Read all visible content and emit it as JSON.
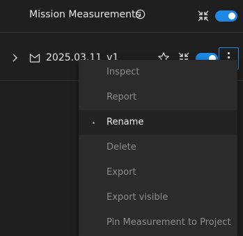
{
  "header": {
    "title": "Mission Measurements",
    "toggle_on": true,
    "accent_color": "#1e88e5"
  },
  "layer_row": {
    "title": "2025.03.11_v1",
    "toggle_on": true
  },
  "context_menu": {
    "items": [
      {
        "label": "Inspect"
      },
      {
        "label": "Report"
      },
      {
        "label": "Rename"
      },
      {
        "label": "Delete"
      },
      {
        "label": "Export"
      },
      {
        "label": "Export visible"
      },
      {
        "label": "Pin Measurement to Project"
      }
    ],
    "active_item": "Rename"
  },
  "icons": [
    "info-icon",
    "collapse-icon",
    "chevron-right-icon",
    "flag-icon",
    "star-icon",
    "more-vertical-icon"
  ]
}
